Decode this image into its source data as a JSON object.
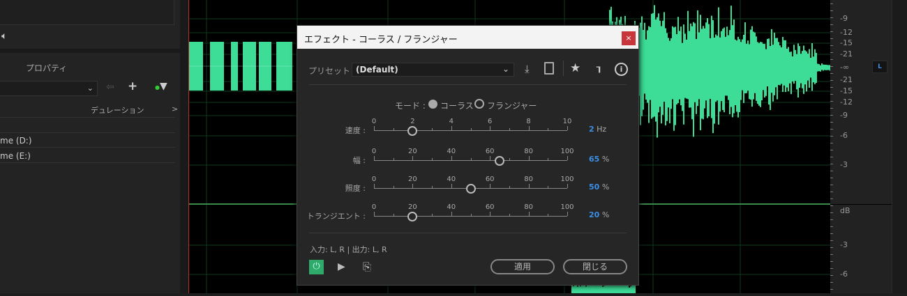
{
  "left_panel": {
    "properties_tab": "プロパティ",
    "column_duration": "デュレーション",
    "column_more": ">",
    "rows": [
      "me (D:)",
      "me (E:)"
    ]
  },
  "ruler": {
    "labels_top": [
      "-9",
      "-12",
      "-15",
      "-21",
      "-∞",
      "-21",
      "-15",
      "-12",
      "-9",
      "-6",
      "-3"
    ],
    "unit": "dB",
    "labels_bottom": [
      "-3",
      "-6"
    ],
    "channel": "L"
  },
  "dialog": {
    "title": "エフェクト - コーラス / フランジャー",
    "close": "×",
    "preset_label": "プリセット :",
    "preset_value": "(Default)",
    "mode_label": "モード :",
    "mode_options": [
      "コーラス",
      "フランジャー"
    ],
    "mode_selected": 0,
    "sliders": [
      {
        "label": "速度 :",
        "ticks": [
          "0",
          "2",
          "4",
          "6",
          "8",
          "10"
        ],
        "min": 0,
        "max": 10,
        "value": 2,
        "value_text": "2",
        "unit": "Hz"
      },
      {
        "label": "幅 :",
        "ticks": [
          "0",
          "20",
          "40",
          "60",
          "80",
          "100"
        ],
        "min": 0,
        "max": 100,
        "value": 65,
        "value_text": "65",
        "unit": "%"
      },
      {
        "label": "照度 :",
        "ticks": [
          "0",
          "20",
          "40",
          "60",
          "80",
          "100"
        ],
        "min": 0,
        "max": 100,
        "value": 50,
        "value_text": "50",
        "unit": "%"
      },
      {
        "label": "トランジエント :",
        "ticks": [
          "0",
          "20",
          "40",
          "60",
          "80",
          "100"
        ],
        "min": 0,
        "max": 100,
        "value": 20,
        "value_text": "20",
        "unit": "%"
      }
    ],
    "io": "入力: L, R | 出力: L, R",
    "apply": "適用",
    "close_button": "閉じる"
  },
  "colors": {
    "wave": "#3ddc97",
    "accent": "#3c8fe6",
    "power": "#2faa6a"
  }
}
